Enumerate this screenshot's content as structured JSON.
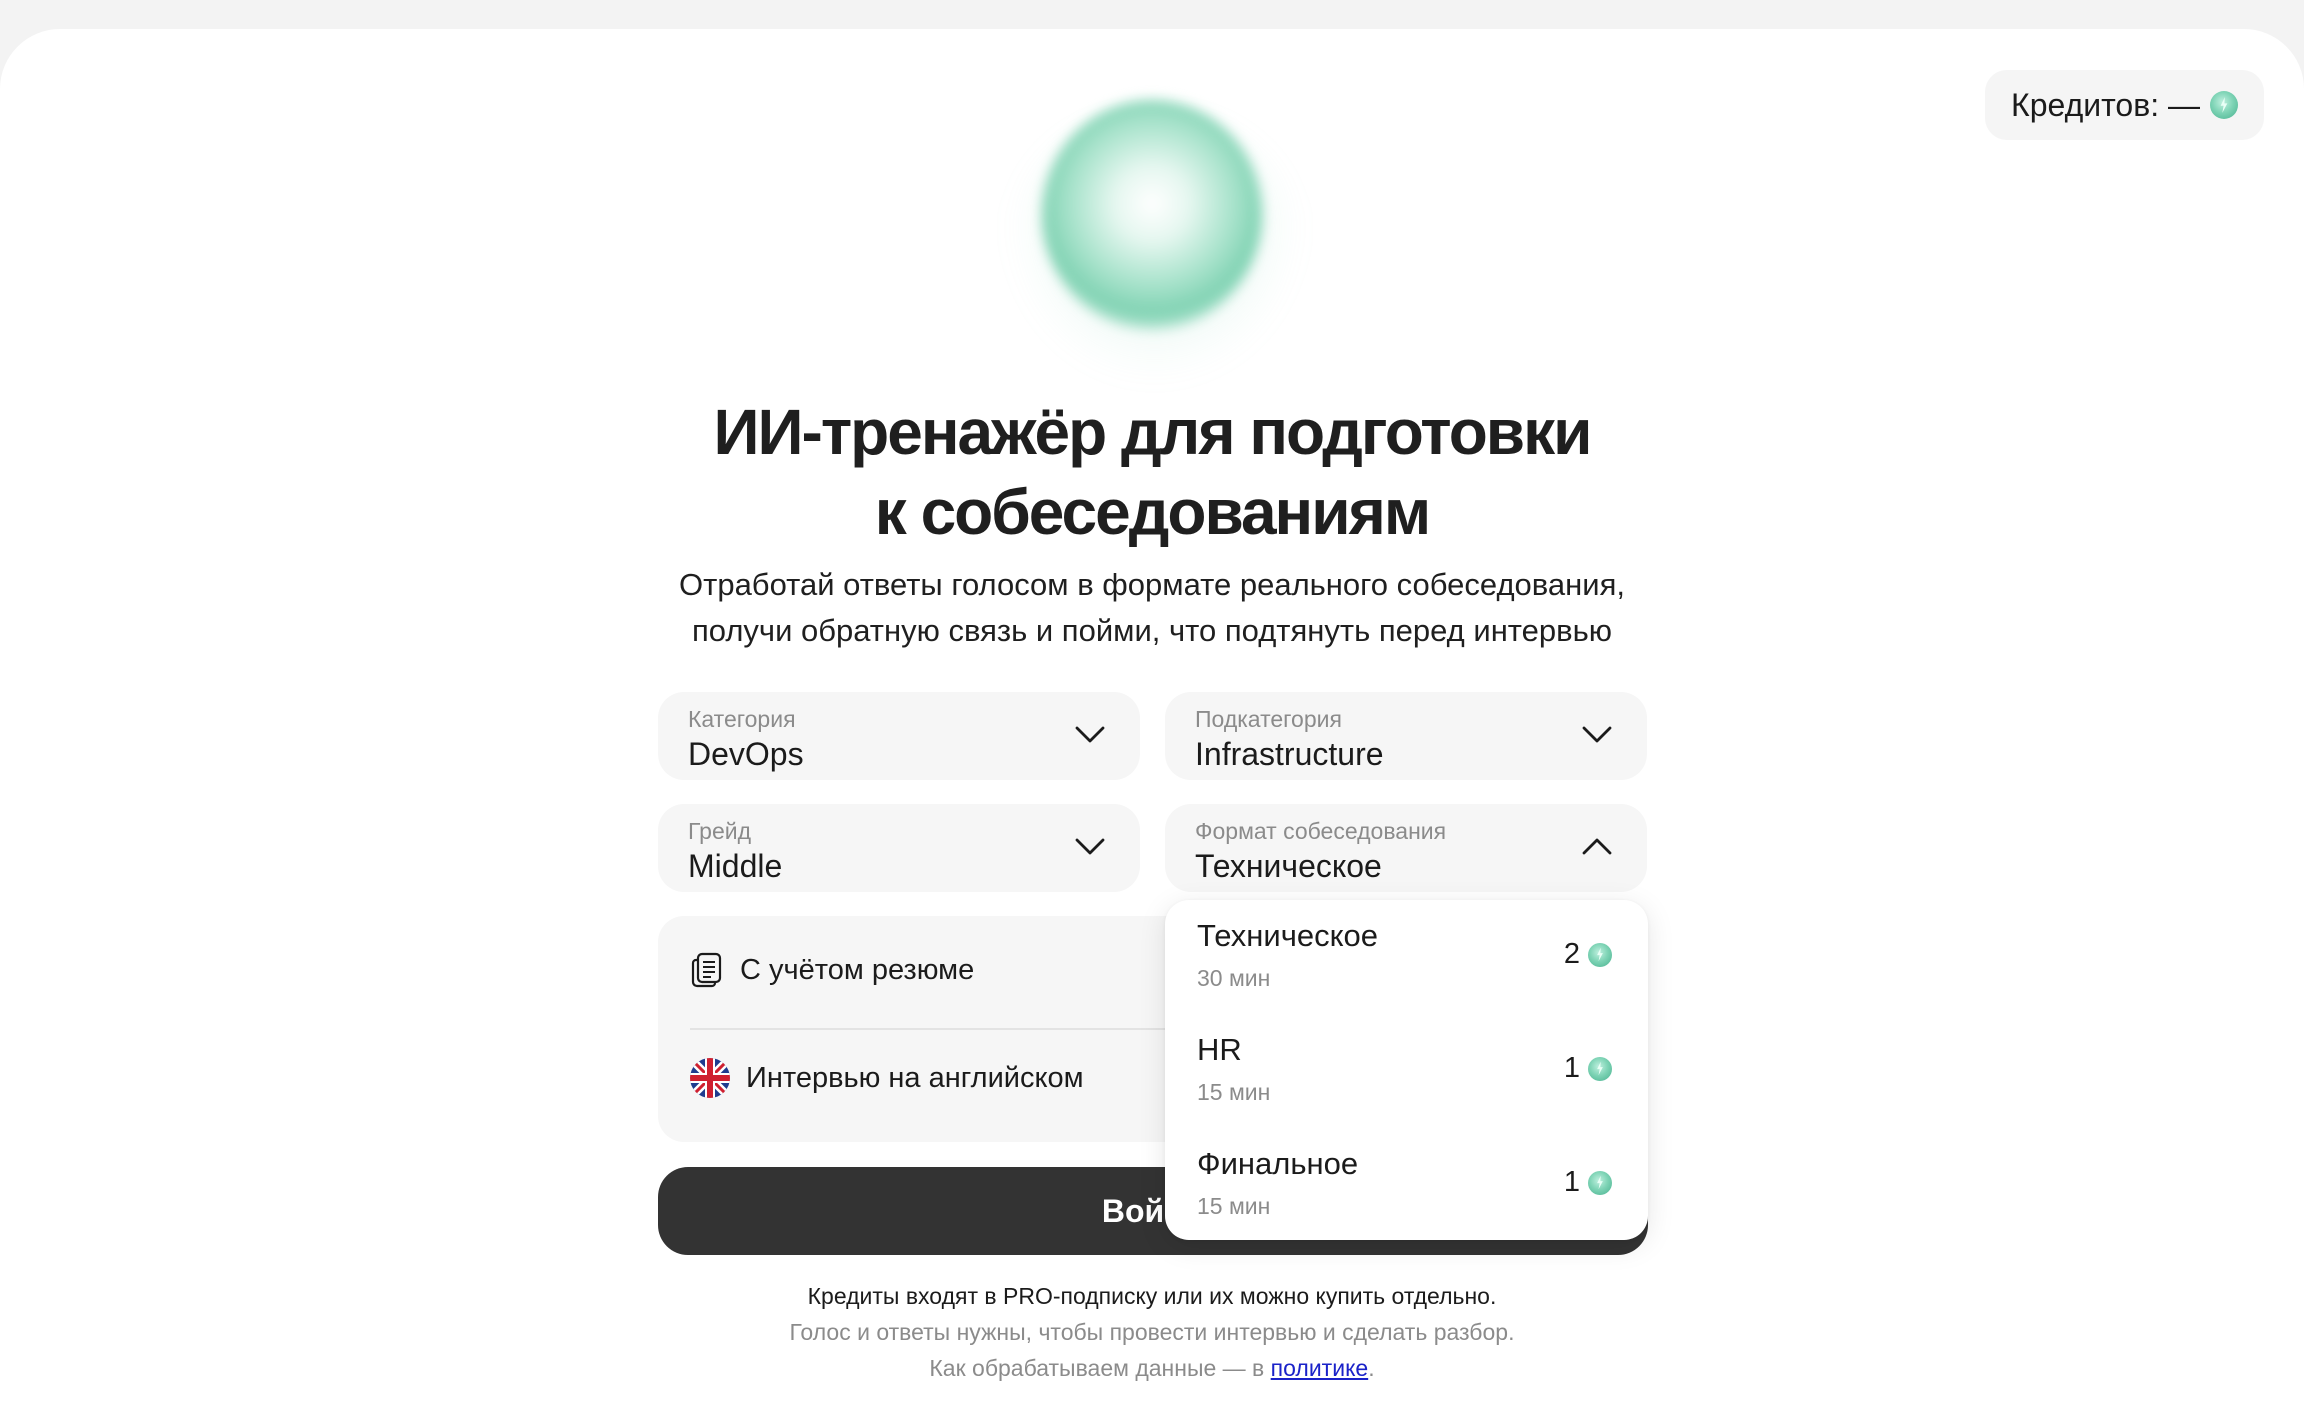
{
  "header": {
    "credits_label": "Кредитов: —",
    "credits_icon": "credit-coin-icon"
  },
  "hero": {
    "title_line1": "ИИ-тренажёр для подготовки",
    "title_line2": "к собеседованиям",
    "subtitle_line1": "Отработай ответы голосом в формате реального собеседования,",
    "subtitle_line2": "получи обратную связь и пойми, что подтянуть перед интервью"
  },
  "form": {
    "category": {
      "label": "Категория",
      "value": "DevOps"
    },
    "subcategory": {
      "label": "Подкатегория",
      "value": "Infrastructure"
    },
    "grade": {
      "label": "Грейд",
      "value": "Middle"
    },
    "format": {
      "label": "Формат собеседования",
      "value": "Техническое"
    },
    "options": {
      "resume": {
        "label": "С учётом резюме",
        "icon": "document-icon"
      },
      "english": {
        "label": "Интервью на английском",
        "icon": "uk-flag-icon"
      }
    },
    "submit_label": "Вой"
  },
  "format_dropdown": {
    "items": [
      {
        "name": "Техническое",
        "duration": "30 мин",
        "cost": "2"
      },
      {
        "name": "HR",
        "duration": "15 мин",
        "cost": "1"
      },
      {
        "name": "Финальное",
        "duration": "15 мин",
        "cost": "1"
      }
    ]
  },
  "footer": {
    "line1": "Кредиты входят в PRO-подписку или их можно купить отдельно.",
    "line2": "Голос и ответы нужны, чтобы провести интервью и сделать разбор.",
    "line3_prefix": "Как обрабатываем данные — в ",
    "line3_link": "политике",
    "line3_suffix": "."
  },
  "colors": {
    "accent": "#7fd4b6",
    "button": "#333333",
    "link": "#1a22c9"
  }
}
